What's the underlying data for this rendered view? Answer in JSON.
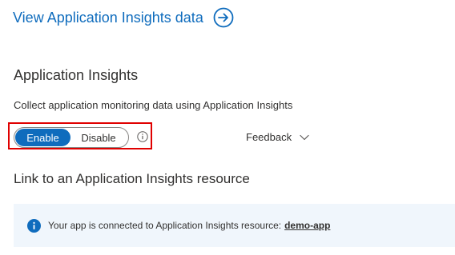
{
  "header": {
    "view_link_label": "View Application Insights data",
    "arrow_icon": "arrow-right-circle-icon"
  },
  "section": {
    "title": "Application Insights",
    "description": "Collect application monitoring data using Application Insights"
  },
  "toggle": {
    "options": [
      "Enable",
      "Disable"
    ],
    "selected": "Enable",
    "info_icon": "info-icon"
  },
  "feedback": {
    "label": "Feedback",
    "icon": "chevron-down-icon"
  },
  "link_section": {
    "title": "Link to an Application Insights resource"
  },
  "infobar": {
    "icon": "info-filled-icon",
    "message": "Your app is connected to Application Insights resource:",
    "resource_link": "demo-app"
  },
  "colors": {
    "accent": "#0f6cbd",
    "highlight_border": "#e00000",
    "infobar_bg": "#f0f6fc"
  }
}
